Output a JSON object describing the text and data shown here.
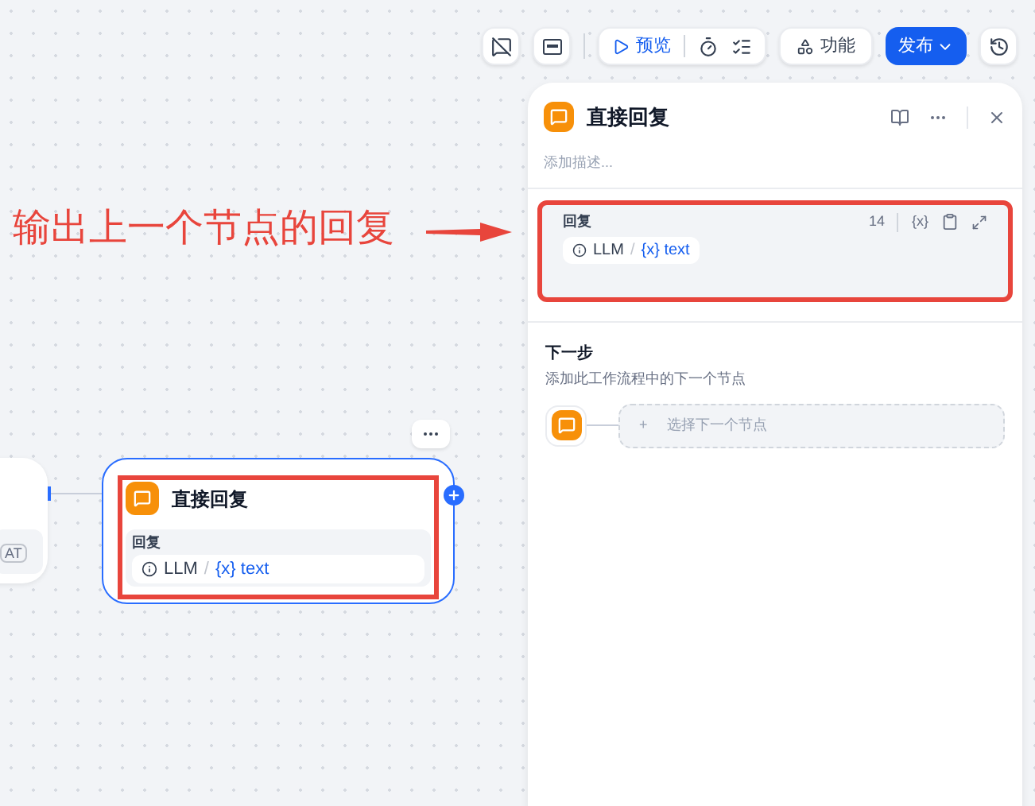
{
  "toolbar": {
    "preview_label": "预览",
    "features_label": "功能",
    "publish_label": "发布"
  },
  "canvas": {
    "left_node": {
      "badge": "AT"
    },
    "node": {
      "title": "直接回复",
      "field_label": "回复",
      "chip": {
        "source": "LLM",
        "separator": "/",
        "var_mark": "{x}",
        "var": "text"
      },
      "highlighted": true
    }
  },
  "annotation": {
    "text": "输出上一个节点的回复"
  },
  "panel": {
    "title": "直接回复",
    "description_placeholder": "添加描述...",
    "field": {
      "label": "回复",
      "count": "14",
      "var_button": "{x}",
      "chip": {
        "source": "LLM",
        "separator": "/",
        "var_mark": "{x}",
        "var": "text"
      },
      "highlighted": true
    },
    "next_step": {
      "title": "下一步",
      "description": "添加此工作流程中的下一个节点",
      "select_plus": "+",
      "select_label": "选择下一个节点"
    }
  }
}
